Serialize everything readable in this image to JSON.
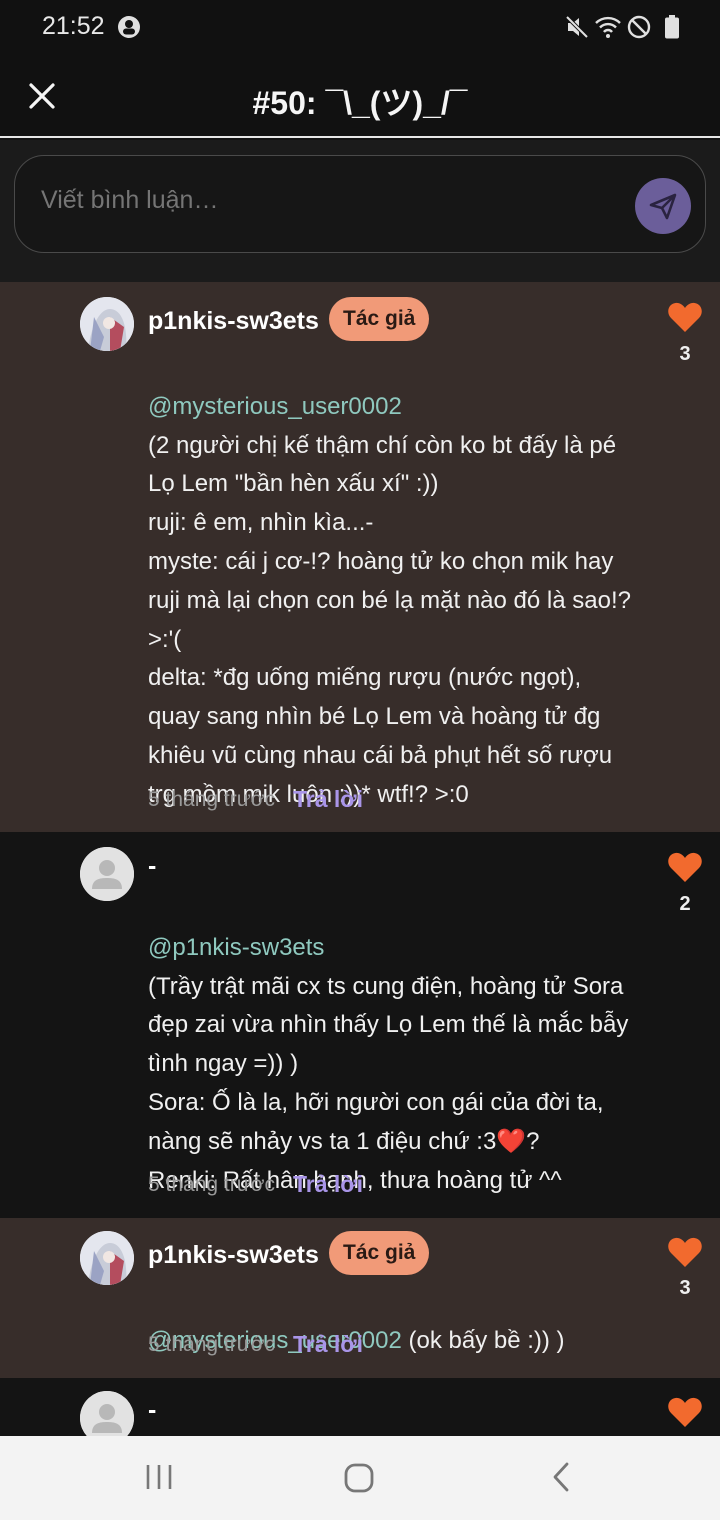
{
  "status_bar": {
    "time": "21:52"
  },
  "header": {
    "title": "#50: ¯\\_(ツ)_/¯"
  },
  "composer": {
    "placeholder": "Viết bình luận…"
  },
  "comments": [
    {
      "username": "p1nkis-sw3ets",
      "badge": "Tác giả",
      "mention": "@mysterious_user0002",
      "text": "(2 người chị kế thậm chí còn ko bt đấy là pé\nLọ Lem \"bần hèn xấu xí\" :))\nruji: ê em, nhìn kìa...-\nmyste: cái j cơ-!? hoàng tử ko chọn mik hay\nruji mà lại chọn con bé lạ mặt nào đó là sao!?\n>:'(\ndelta: *đg uống miếng rượu (nước ngọt),\nquay sang nhìn bé Lọ Lem và hoàng tử đg\nkhiêu vũ cùng nhau cái bả phụt hết số rượu\ntrg mồm mik luôn :))* wtf!? >:0",
      "time": "5 tháng trước",
      "reply": "Trả lời",
      "likes": "3"
    },
    {
      "username": "-",
      "mention": "@p1nkis-sw3ets",
      "text": "(Trầy trật mãi cx ts cung điện, hoàng tử Sora\nđẹp zai vừa nhìn thấy Lọ Lem thế là mắc bẫy\ntình ngay =)) )\nSora: Ố là la, hỡi người con gái của đời ta,\nnàng sẽ nhảy vs ta 1 điệu chứ :3❤️?\nRenki: Rất hân hạnh, thưa hoàng tử ^^",
      "time": "5 tháng trước",
      "reply": "Trả lời",
      "likes": "2"
    },
    {
      "username": "p1nkis-sw3ets",
      "badge": "Tác giả",
      "mention": "@mysterious_user0002",
      "text": " (ok bấy bề :)) )",
      "time": "5 tháng trước",
      "reply": "Trả lời",
      "likes": "3"
    },
    {
      "username": "-"
    }
  ],
  "colors": {
    "accent_purple": "#a995e8",
    "badge_salmon": "#f19a78",
    "heart_orange": "#f26a2e",
    "mention_teal": "#8fc9bf",
    "author_bg": "#372d2a"
  },
  "icons": {
    "close": "close-icon",
    "send": "send-icon",
    "heart": "heart-icon",
    "nav_recent": "recent-apps-icon",
    "nav_home": "home-icon",
    "nav_back": "back-icon"
  }
}
